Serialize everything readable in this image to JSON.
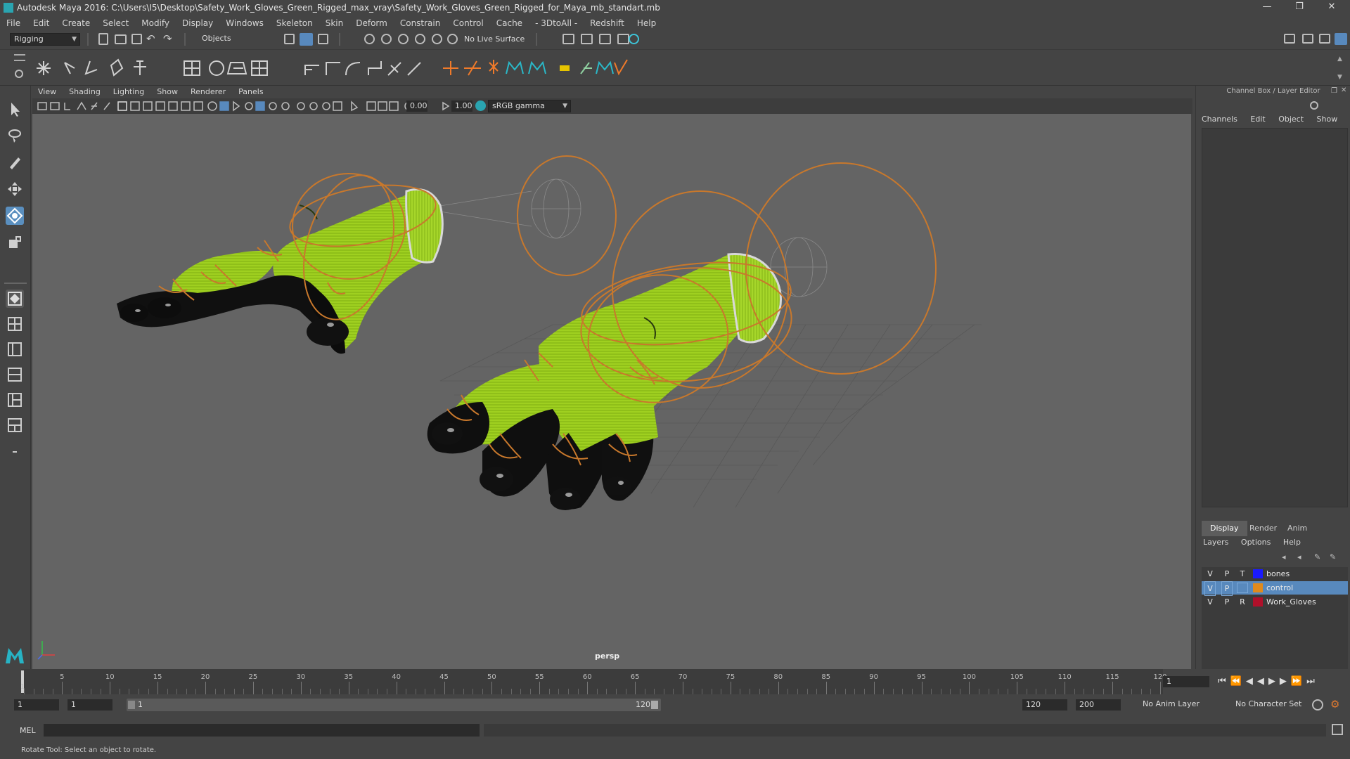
{
  "window": {
    "title": "Autodesk Maya 2016: C:\\Users\\I5\\Desktop\\Safety_Work_Gloves_Green_Rigged_max_vray\\Safety_Work_Gloves_Green_Rigged_for_Maya_mb_standart.mb",
    "min": "—",
    "max": "❐",
    "close": "✕"
  },
  "menubar": [
    "File",
    "Edit",
    "Create",
    "Select",
    "Modify",
    "Display",
    "Windows",
    "Skeleton",
    "Skin",
    "Deform",
    "Constrain",
    "Control",
    "Cache",
    "- 3DtoAll -",
    "Redshift",
    "Help"
  ],
  "statusline": {
    "mode": "Rigging",
    "selection_mode": "Objects",
    "live_surface": "No Live Surface"
  },
  "viewport": {
    "menu": [
      "View",
      "Shading",
      "Lighting",
      "Show",
      "Renderer",
      "Panels"
    ],
    "exposure": "0.00",
    "gamma": "1.00",
    "color_space": "sRGB gamma",
    "camera": "persp"
  },
  "channelbox": {
    "title": "Channel Box / Layer Editor",
    "menu": [
      "Channels",
      "Edit",
      "Object",
      "Show"
    ],
    "tabs": [
      "Display",
      "Render",
      "Anim"
    ],
    "layer_menu": [
      "Layers",
      "Options",
      "Help"
    ],
    "layers": [
      {
        "v": "V",
        "p": "P",
        "t": "T",
        "name": "bones",
        "color": "#1a1aff"
      },
      {
        "v": "V",
        "p": "P",
        "t": "",
        "name": "control",
        "color": "#e08a1c"
      },
      {
        "v": "V",
        "p": "P",
        "t": "R",
        "name": "Work_Gloves",
        "color": "#b0102a"
      }
    ]
  },
  "timeline": {
    "ticks": [
      "5",
      "10",
      "15",
      "20",
      "25",
      "30",
      "35",
      "40",
      "45",
      "50",
      "55",
      "60",
      "65",
      "70",
      "75",
      "80",
      "85",
      "90",
      "95",
      "100",
      "105",
      "110",
      "115",
      "120"
    ],
    "start_label": "1",
    "current_frame": "1"
  },
  "range": {
    "start": "1",
    "anim_start": "1",
    "slider_start": "1",
    "slider_end": "120",
    "end": "120",
    "anim_end": "200",
    "anim_layer": "No Anim Layer",
    "character_set": "No Character Set"
  },
  "cmdline": {
    "label": "MEL"
  },
  "help": "Rotate Tool: Select an object to rotate.",
  "colors": {
    "glove": "#9fd020",
    "rubber": "#0e0e0e",
    "controls": "#c8782c",
    "selection": "#5889bd"
  }
}
